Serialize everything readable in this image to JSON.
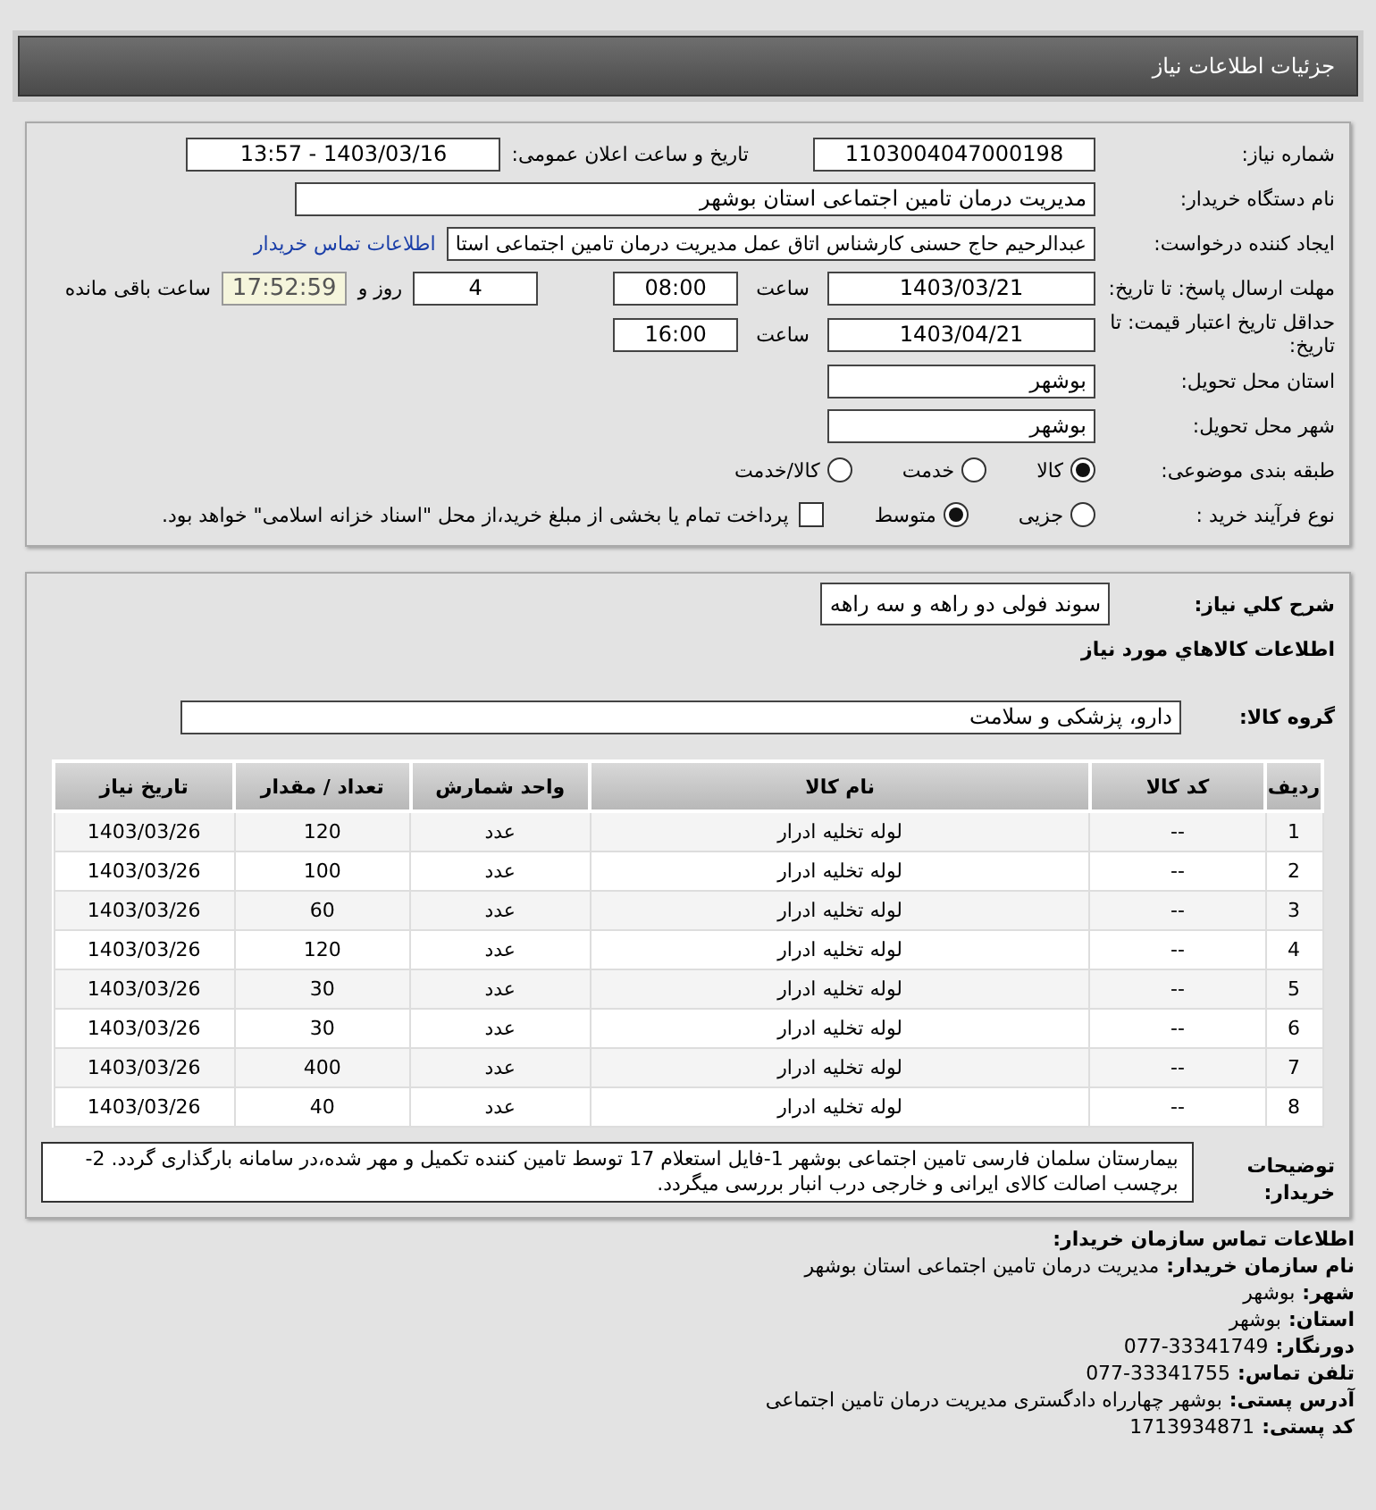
{
  "header": {
    "title": "جزئیات اطلاعات نیاز"
  },
  "details": {
    "need_number": {
      "label": "شماره نیاز:",
      "value": "1103004047000198"
    },
    "announce": {
      "label": "تاریخ و ساعت اعلان عمومی:",
      "value": "1403/03/16 - 13:57"
    },
    "buyer": {
      "label": "نام دستگاه خریدار:",
      "value": "مدیریت درمان تامین اجتماعی استان بوشهر"
    },
    "requester": {
      "label": "ایجاد کننده درخواست:",
      "value": "عبدالرحیم حاج حسنی کارشناس اتاق عمل مدیریت درمان تامین اجتماعی استا",
      "link": "اطلاعات تماس خریدار"
    },
    "deadline": {
      "label": "مهلت ارسال پاسخ: تا تاریخ:",
      "date": "1403/03/21",
      "time_label": "ساعت",
      "time": "08:00",
      "days": "4",
      "days_label": "روز و",
      "remaining": "17:52:59",
      "remaining_label": "ساعت باقی مانده"
    },
    "validity": {
      "label": "حداقل تاریخ اعتبار قیمت: تا تاریخ:",
      "date": "1403/04/21",
      "time_label": "ساعت",
      "time": "16:00"
    },
    "province": {
      "label": "استان محل تحویل:",
      "value": "بوشهر"
    },
    "city": {
      "label": "شهر محل تحویل:",
      "value": "بوشهر"
    },
    "category": {
      "label": "طبقه بندی موضوعی:",
      "options": [
        {
          "label": "کالا",
          "selected": true
        },
        {
          "label": "خدمت",
          "selected": false
        },
        {
          "label": "کالا/خدمت",
          "selected": false
        }
      ]
    },
    "purchase": {
      "label": "نوع فرآیند خرید :",
      "options": [
        {
          "label": "جزیی",
          "selected": false
        },
        {
          "label": "متوسط",
          "selected": true
        }
      ],
      "payment": {
        "label": "پرداخت تمام یا بخشی از مبلغ خرید،از محل \"اسناد خزانه اسلامی\" خواهد بود.",
        "checked": false
      }
    }
  },
  "summary": {
    "label": "شرح کلي نياز:",
    "value": "سوند فولی دو راهه و سه راهه"
  },
  "goods_title": "اطلاعات کالاهاي مورد نياز",
  "group": {
    "label": "گروه کالا:",
    "value": "دارو، پزشکی و سلامت"
  },
  "table": {
    "columns": [
      "ردیف",
      "کد کالا",
      "نام کالا",
      "واحد شمارش",
      "تعداد / مقدار",
      "تاریخ نیاز"
    ],
    "rows": [
      [
        "1",
        "--",
        "لوله تخلیه ادرار",
        "عدد",
        "120",
        "1403/03/26"
      ],
      [
        "2",
        "--",
        "لوله تخلیه ادرار",
        "عدد",
        "100",
        "1403/03/26"
      ],
      [
        "3",
        "--",
        "لوله تخلیه ادرار",
        "عدد",
        "60",
        "1403/03/26"
      ],
      [
        "4",
        "--",
        "لوله تخلیه ادرار",
        "عدد",
        "120",
        "1403/03/26"
      ],
      [
        "5",
        "--",
        "لوله تخلیه ادرار",
        "عدد",
        "30",
        "1403/03/26"
      ],
      [
        "6",
        "--",
        "لوله تخلیه ادرار",
        "عدد",
        "30",
        "1403/03/26"
      ],
      [
        "7",
        "--",
        "لوله تخلیه ادرار",
        "عدد",
        "400",
        "1403/03/26"
      ],
      [
        "8",
        "--",
        "لوله تخلیه ادرار",
        "عدد",
        "40",
        "1403/03/26"
      ]
    ]
  },
  "notes": {
    "label": "توضیحات خریدار:",
    "text": "بیمارستان سلمان فارسی تامین اجتماعی بوشهر 1-فایل استعلام 17 توسط تامین کننده تکمیل و مهر شده،در سامانه بارگذاری گردد. 2-برچسب اصالت کالای ایرانی و خارجی درب انبار بررسی میگردد."
  },
  "contact": {
    "title": "اطلاعات تماس سازمان خریدار:",
    "lines": [
      {
        "label": "نام سازمان خریدار:",
        "value": "مدیریت درمان تامین اجتماعی استان بوشهر"
      },
      {
        "label": "شهر:",
        "value": "بوشهر"
      },
      {
        "label": "استان:",
        "value": "بوشهر"
      },
      {
        "label": "دورنگار:",
        "value": "077-33341749"
      },
      {
        "label": "تلفن تماس:",
        "value": "077-33341755"
      },
      {
        "label": "آدرس پستی:",
        "value": "بوشهر چهارراه دادگستری مدیریت درمان تامین اجتماعی"
      },
      {
        "label": "کد پستی:",
        "value": "1713934871"
      }
    ]
  }
}
